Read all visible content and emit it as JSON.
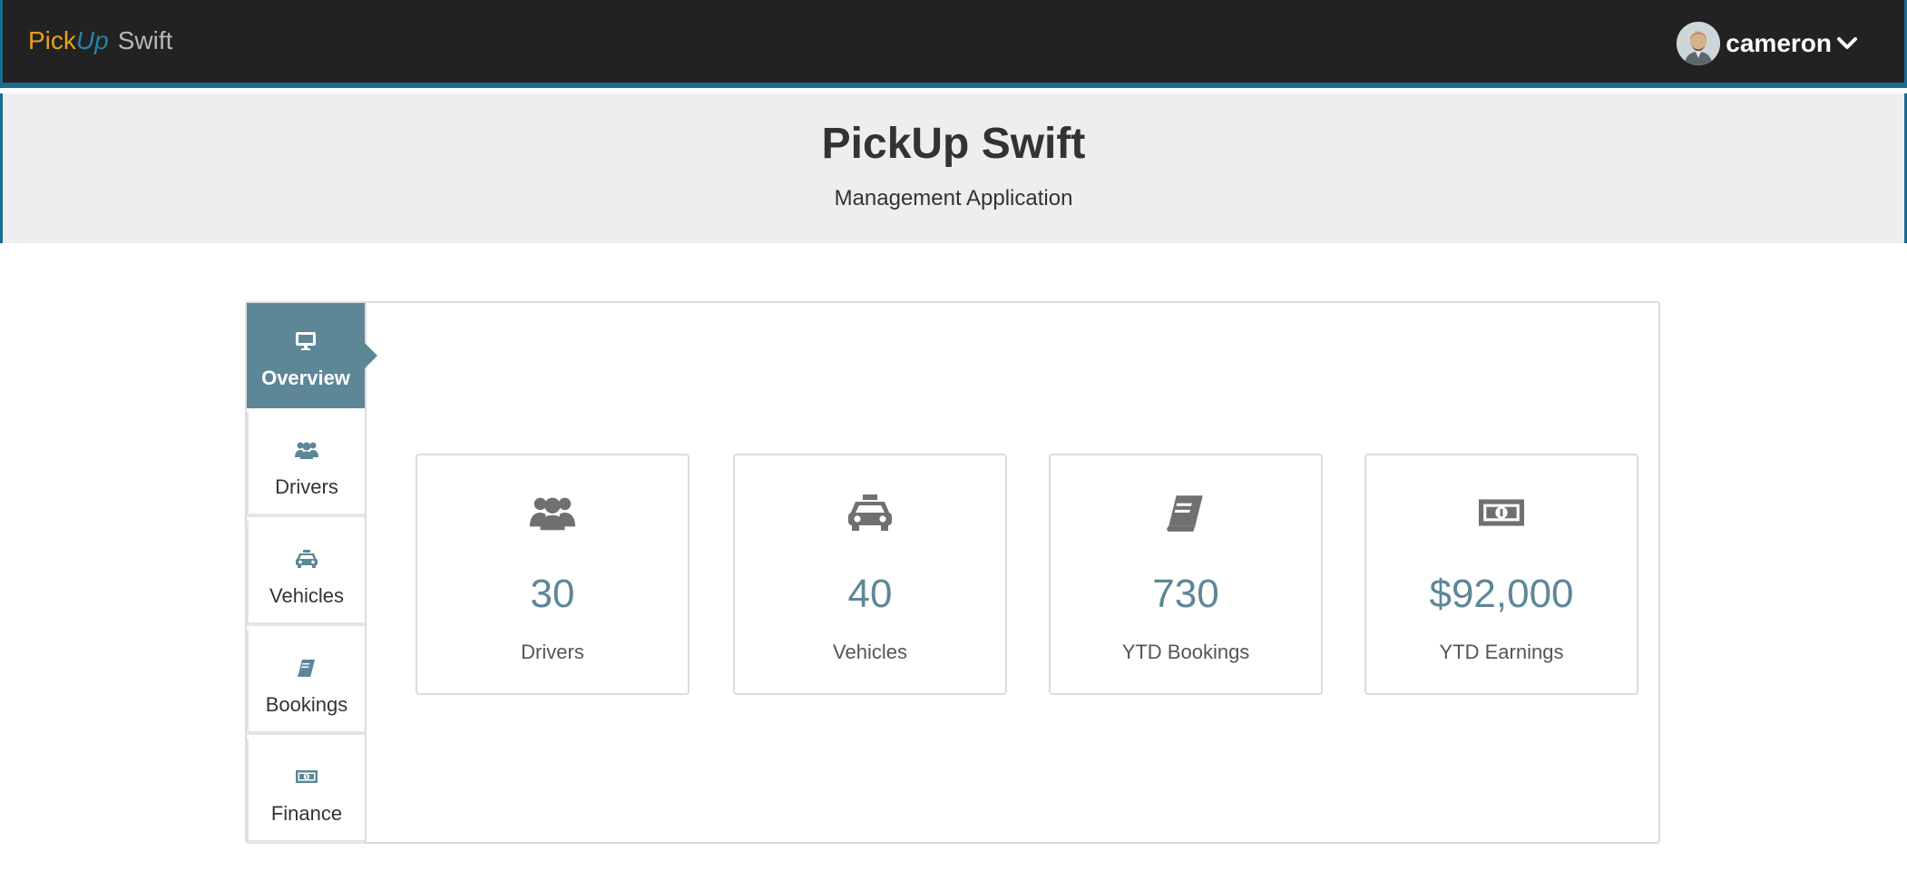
{
  "brand": {
    "pick": "Pick",
    "up": "Up",
    "swift": "Swift"
  },
  "user": {
    "name": "cameron",
    "avatar_icon": "user-avatar"
  },
  "hero": {
    "title": "PickUp Swift",
    "subtitle": "Management Application"
  },
  "sidebar": {
    "items": [
      {
        "label": "Overview",
        "icon": "monitor-icon",
        "active": true
      },
      {
        "label": "Drivers",
        "icon": "users-icon",
        "active": false
      },
      {
        "label": "Vehicles",
        "icon": "taxi-icon",
        "active": false
      },
      {
        "label": "Bookings",
        "icon": "book-icon",
        "active": false
      },
      {
        "label": "Finance",
        "icon": "money-bill-icon",
        "active": false
      }
    ]
  },
  "stats": [
    {
      "value": "30",
      "label": "Drivers",
      "icon": "users-icon"
    },
    {
      "value": "40",
      "label": "Vehicles",
      "icon": "taxi-icon"
    },
    {
      "value": "730",
      "label": "YTD Bookings",
      "icon": "book-icon"
    },
    {
      "value": "$92,000",
      "label": "YTD Earnings",
      "icon": "money-bill-icon"
    }
  ],
  "colors": {
    "topbar": "#222222",
    "accent_border": "#1b6b8c",
    "brand_pick": "#e8a21e",
    "brand_up": "#2a7fa8",
    "active_nav": "#5d8797",
    "stat_value": "#5d8797",
    "icon_grey": "#707070"
  }
}
